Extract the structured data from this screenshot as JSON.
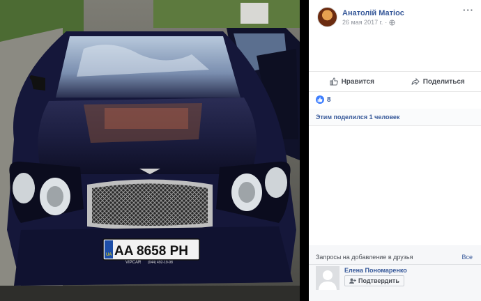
{
  "post": {
    "author_name": "Анатолій Матіос",
    "date": "26 мая 2017 г.",
    "more_label": "···",
    "like_label": "Нравится",
    "share_label": "Поделиться",
    "reactions_count": "8",
    "shares_text": "Этим поделился 1 человек"
  },
  "photo": {
    "plate_text": "AA 8658 PH",
    "plate_country": "UA",
    "dealer_text": "VIPCAR",
    "dealer_phone": "(044) 492-19-98"
  },
  "friend_requests": {
    "heading": "Запросы на добавление в друзья",
    "see_all": "Все",
    "name": "Елена Пономаренко",
    "confirm_label": "Подтвердить"
  },
  "colors": {
    "link": "#365899",
    "like_blue": "#4080ff",
    "car_body": "#141638"
  }
}
